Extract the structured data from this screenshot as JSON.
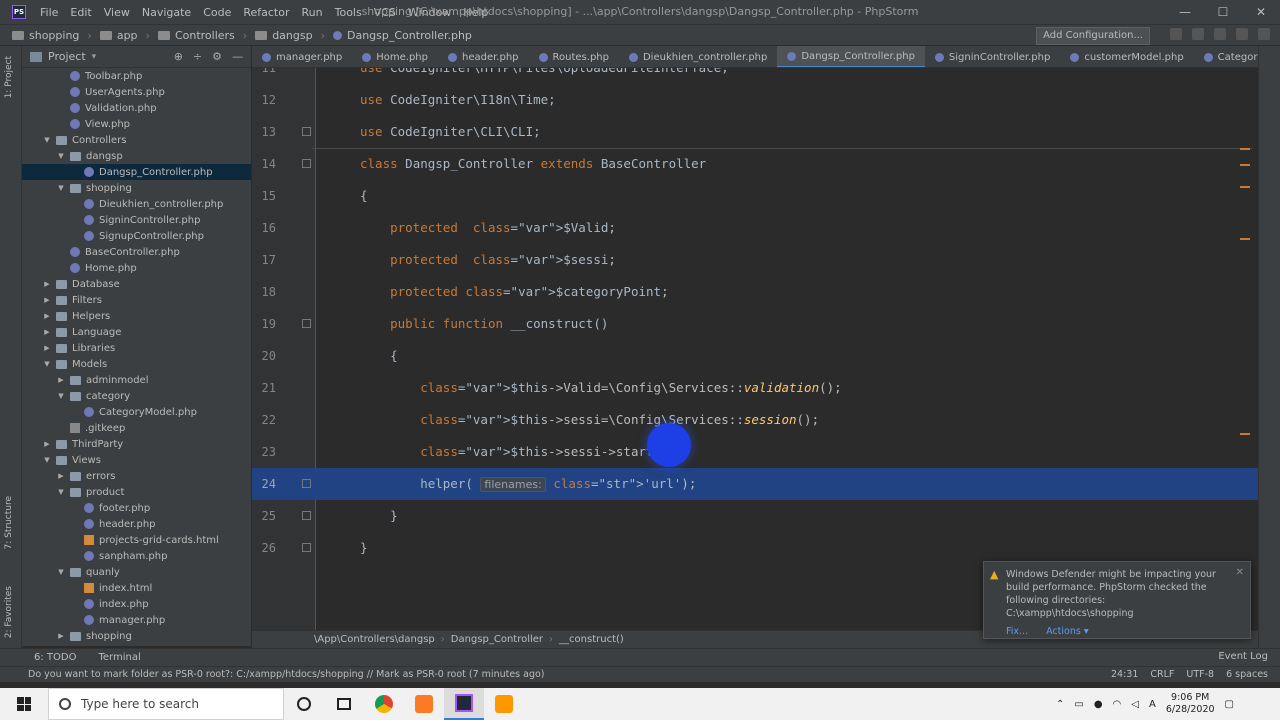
{
  "window": {
    "title": "shopping [C:\\xampp\\htdocs\\shopping] - ...\\app\\Controllers\\dangsp\\Dangsp_Controller.php - PhpStorm",
    "menu": [
      "File",
      "Edit",
      "View",
      "Navigate",
      "Code",
      "Refactor",
      "Run",
      "Tools",
      "VCS",
      "Window",
      "Help"
    ],
    "app_icon": "PS",
    "controls": {
      "minimize": "—",
      "maximize": "☐",
      "close": "✕"
    }
  },
  "navbar": {
    "breadcrumb": [
      "shopping",
      "app",
      "Controllers",
      "dangsp",
      "Dangsp_Controller.php"
    ],
    "add_config": "Add Configuration..."
  },
  "project": {
    "title": "Project",
    "caret": "▾",
    "tools": [
      "⊕",
      "÷",
      "⚙",
      "—"
    ],
    "tree": [
      {
        "label": "Toolbar.php",
        "type": "php",
        "depth": 3
      },
      {
        "label": "UserAgents.php",
        "type": "php",
        "depth": 3
      },
      {
        "label": "Validation.php",
        "type": "php",
        "depth": 3
      },
      {
        "label": "View.php",
        "type": "php",
        "depth": 3
      },
      {
        "label": "Controllers",
        "type": "folder",
        "depth": 2,
        "open": true
      },
      {
        "label": "dangsp",
        "type": "folder",
        "depth": 3,
        "open": true
      },
      {
        "label": "Dangsp_Controller.php",
        "type": "php",
        "depth": 4,
        "selected": true
      },
      {
        "label": "shopping",
        "type": "folder",
        "depth": 3,
        "open": true
      },
      {
        "label": "Dieukhien_controller.php",
        "type": "php",
        "depth": 4
      },
      {
        "label": "SigninController.php",
        "type": "php",
        "depth": 4
      },
      {
        "label": "SignupController.php",
        "type": "php",
        "depth": 4
      },
      {
        "label": "BaseController.php",
        "type": "php",
        "depth": 3
      },
      {
        "label": "Home.php",
        "type": "php",
        "depth": 3
      },
      {
        "label": "Database",
        "type": "folder",
        "depth": 2,
        "open": false
      },
      {
        "label": "Filters",
        "type": "folder",
        "depth": 2,
        "open": false
      },
      {
        "label": "Helpers",
        "type": "folder",
        "depth": 2,
        "open": false
      },
      {
        "label": "Language",
        "type": "folder",
        "depth": 2,
        "open": false
      },
      {
        "label": "Libraries",
        "type": "folder",
        "depth": 2,
        "open": false
      },
      {
        "label": "Models",
        "type": "folder",
        "depth": 2,
        "open": true
      },
      {
        "label": "adminmodel",
        "type": "folder",
        "depth": 3,
        "open": false
      },
      {
        "label": "category",
        "type": "folder",
        "depth": 3,
        "open": true
      },
      {
        "label": "CategoryModel.php",
        "type": "php",
        "depth": 4
      },
      {
        "label": ".gitkeep",
        "type": "git",
        "depth": 3
      },
      {
        "label": "ThirdParty",
        "type": "folder",
        "depth": 2,
        "open": false
      },
      {
        "label": "Views",
        "type": "folder",
        "depth": 2,
        "open": true
      },
      {
        "label": "errors",
        "type": "folder",
        "depth": 3,
        "open": false
      },
      {
        "label": "product",
        "type": "folder",
        "depth": 3,
        "open": true
      },
      {
        "label": "footer.php",
        "type": "php",
        "depth": 4
      },
      {
        "label": "header.php",
        "type": "php",
        "depth": 4
      },
      {
        "label": "projects-grid-cards.html",
        "type": "html",
        "depth": 4
      },
      {
        "label": "sanpham.php",
        "type": "php",
        "depth": 4
      },
      {
        "label": "quanly",
        "type": "folder",
        "depth": 3,
        "open": true
      },
      {
        "label": "index.html",
        "type": "html",
        "depth": 4
      },
      {
        "label": "index.php",
        "type": "php",
        "depth": 4
      },
      {
        "label": "manager.php",
        "type": "php",
        "depth": 4
      },
      {
        "label": "shopping",
        "type": "folder",
        "depth": 3,
        "open": false
      }
    ]
  },
  "tabs": [
    "manager.php",
    "Home.php",
    "header.php",
    "Routes.php",
    "Dieukhien_controller.php",
    "Dangsp_Controller.php",
    "SigninController.php",
    "customerModel.php",
    "CategoryMo"
  ],
  "active_tab": "Dangsp_Controller.php",
  "editor": {
    "lines": [
      {
        "num": "11",
        "text": "use CodeIgniter\\HTTP\\Files\\UploadedFileInterface;"
      },
      {
        "num": "12",
        "text": "use CodeIgniter\\I18n\\Time;"
      },
      {
        "num": "13",
        "text": "use CodeIgniter\\CLI\\CLI;"
      },
      {
        "num": "14",
        "text": "class Dangsp_Controller extends BaseController"
      },
      {
        "num": "15",
        "text": "{"
      },
      {
        "num": "16",
        "text": "    protected  $Valid;"
      },
      {
        "num": "17",
        "text": "    protected  $sessi;"
      },
      {
        "num": "18",
        "text": "    protected $categoryPoint;"
      },
      {
        "num": "19",
        "text": "    public function __construct()"
      },
      {
        "num": "20",
        "text": "    {"
      },
      {
        "num": "21",
        "text": "        $this->Valid=\\Config\\Services::validation();"
      },
      {
        "num": "22",
        "text": "        $this->sessi=\\Config\\Services::session();"
      },
      {
        "num": "23",
        "text": "        $this->sessi->start();"
      },
      {
        "num": "24",
        "text": "        helper( filenames: 'url');"
      },
      {
        "num": "25",
        "text": "    }"
      },
      {
        "num": "26",
        "text": "}"
      }
    ],
    "current_line": "24",
    "param_hint": "filenames:"
  },
  "code_breadcrumb": [
    "\\App\\Controllers\\dangsp",
    "Dangsp_Controller",
    "__construct()"
  ],
  "side_labels": {
    "project": "1: Project",
    "structure": "7: Structure",
    "favorites": "2: Favorites"
  },
  "toolbar": {
    "todo": "6: TODO",
    "terminal": "Terminal",
    "event_log": "Event Log"
  },
  "status": {
    "message": "Do you want to mark folder as PSR-0 root?: C:/xampp/htdocs/shopping // Mark as PSR-0 root (7 minutes ago)",
    "position": "24:31",
    "line_sep": "CRLF",
    "encoding": "UTF-8",
    "indent": "6 spaces"
  },
  "notification": {
    "text": "Windows Defender might be impacting your build performance. PhpStorm checked the following directories:",
    "path": "C:\\xampp\\htdocs\\shopping",
    "fix": "Fix...",
    "actions": "Actions ▾"
  },
  "taskbar": {
    "search_placeholder": "Type here to search",
    "time": "9:06 PM",
    "date": "6/28/2020"
  },
  "colors": {
    "accent": "#214283",
    "keyword": "#cc7832",
    "variable": "#9876aa",
    "string": "#6a8759"
  }
}
